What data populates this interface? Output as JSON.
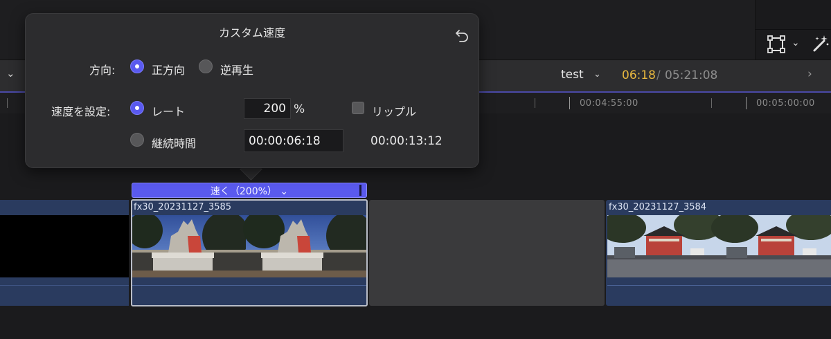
{
  "popover": {
    "title": "カスタム速度",
    "direction_label": "方向:",
    "direction_forward": "正方向",
    "direction_reverse": "逆再生",
    "speed_label": "速度を設定:",
    "rate_option": "レート",
    "rate_value": "200",
    "rate_unit": "%",
    "ripple_label": "リップル",
    "duration_option": "継続時間",
    "duration_value": "00:00:06:18",
    "resulting_duration": "00:00:13:12",
    "selected_direction": "正方向",
    "selected_mode": "レート",
    "ripple_checked": false
  },
  "toolbar": {
    "project_name": "test",
    "current_time": "06:18",
    "separator": "/",
    "total_duration": "05:21:08"
  },
  "ruler": {
    "labels": [
      "00:04:55:00",
      "00:05:00:00"
    ]
  },
  "timeline": {
    "speed_label": "速く（200%）",
    "clips": [
      {
        "name": "fx30_20231127_3585"
      },
      {
        "name": "fx30_20231127_3584"
      }
    ]
  },
  "icons": {
    "reset": "undo-arrow-icon",
    "transform": "transform-icon",
    "magic": "magic-wand-icon"
  },
  "colors": {
    "accent": "#5a5aee",
    "timecode_current": "#e8b83f",
    "clip_body": "#2a3b5f"
  }
}
